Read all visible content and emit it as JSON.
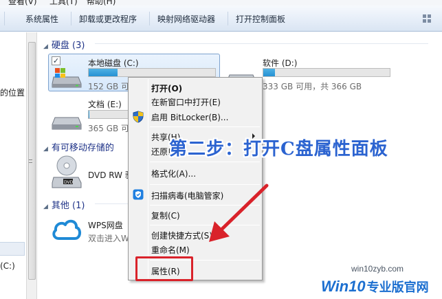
{
  "menubar": {
    "items": [
      "查看(V)",
      "工具(T)",
      "帮助(H)"
    ]
  },
  "toolbar": {
    "buttons": [
      "系统属性",
      "卸载或更改程序",
      "映射网络驱动器",
      "打开控制面板"
    ]
  },
  "navpane": {
    "fragment_location": "的位置",
    "fragment_c": "(C:)"
  },
  "groups": {
    "hard_disks": {
      "title": "硬盘 (3)"
    },
    "removable": {
      "title": "有可移动存储的"
    },
    "other": {
      "title": "其他 (1)"
    }
  },
  "drives": {
    "c": {
      "name": "本地磁盘 (C:)",
      "free_text": "152 GB 可",
      "fill_fraction": 0.23
    },
    "d": {
      "name": "软件 (D:)",
      "free_text": "333 GB 可用，共 366 GB",
      "fill_fraction": 0.09
    },
    "e": {
      "name": "文档 (E:)",
      "free_text": "365 GB 可",
      "fill_fraction": 0.02
    },
    "dvd": {
      "name": "DVD RW 驱"
    },
    "wps": {
      "name": "WPS网盘",
      "subtitle": "双击进入W"
    }
  },
  "context_menu": {
    "open": "打开(O)",
    "open_new_window": "在新窗口中打开(E)",
    "bitlocker": "启用 BitLocker(B)...",
    "share": "共享(H)",
    "restore": "还原以",
    "format": "格式化(A)...",
    "scan": "扫描病毒(电脑管家)",
    "copy": "复制(C)",
    "create_shortcut": "创建快捷方式(S)",
    "rename": "重命名(M)",
    "properties": "属性(R)"
  },
  "annotation": {
    "step": "第二步：打开C盘属性面板"
  },
  "watermark": {
    "url": "win10zyb.com",
    "brand": "Win10",
    "brand_sub": "专业版官网"
  },
  "colors": {
    "accent_annotation": "#2b63d0",
    "highlight_box": "#d9222a",
    "drive_bar": "#2691d3"
  }
}
